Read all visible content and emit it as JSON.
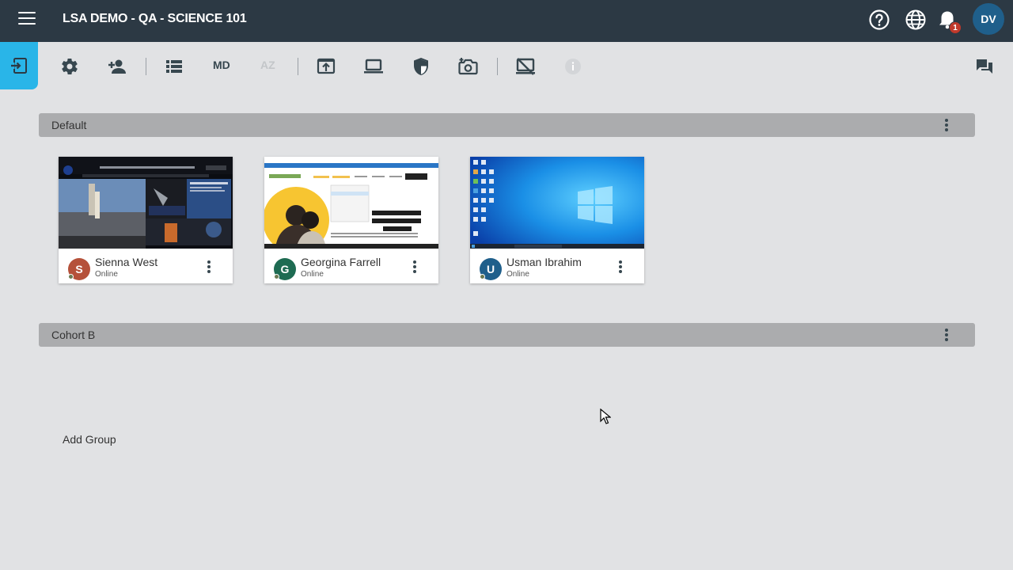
{
  "header": {
    "title": "LSA DEMO - QA - SCIENCE 101",
    "notification_count": "1",
    "user_initials": "DV"
  },
  "toolbar": {
    "md_label": "MD",
    "az_label": "AZ"
  },
  "groups": [
    {
      "name": "Default",
      "students": [
        {
          "name": "Sienna West",
          "status": "Online",
          "initial": "S",
          "color": "#b5513a"
        },
        {
          "name": "Georgina Farrell",
          "status": "Online",
          "initial": "G",
          "color": "#1e6b52"
        },
        {
          "name": "Usman Ibrahim",
          "status": "Online",
          "initial": "U",
          "color": "#1f5f8b"
        }
      ]
    },
    {
      "name": "Cohort B",
      "students": []
    }
  ],
  "add_group_label": "Add Group",
  "colors": {
    "topbar": "#2c3944",
    "accent": "#29b5e8",
    "background": "#e1e2e4"
  }
}
